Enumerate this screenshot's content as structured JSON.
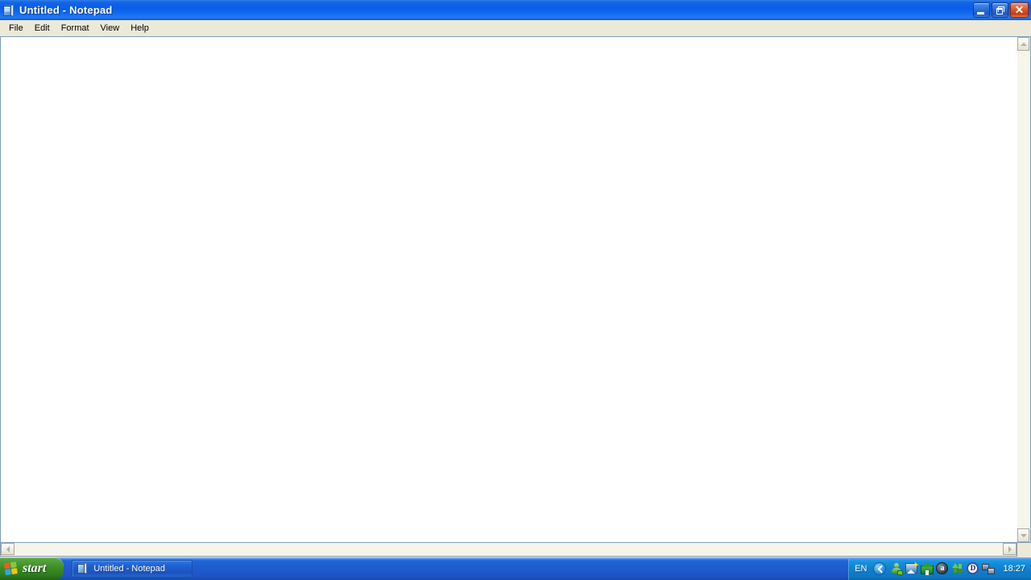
{
  "window": {
    "title": "Untitled - Notepad",
    "icon": "notepad-document-icon",
    "buttons": {
      "minimize": "_",
      "restore": "restore",
      "close": "✕"
    }
  },
  "menu": {
    "items": [
      {
        "label": "File"
      },
      {
        "label": "Edit"
      },
      {
        "label": "Format"
      },
      {
        "label": "View"
      },
      {
        "label": "Help"
      }
    ]
  },
  "editor": {
    "content": "",
    "scrollbars": {
      "vertical": {
        "up": "scroll-up",
        "down": "scroll-down"
      },
      "horizontal": {
        "left": "scroll-left",
        "right": "scroll-right"
      }
    }
  },
  "taskbar": {
    "start": {
      "label": "start",
      "icon": "windows-flag-icon"
    },
    "task_buttons": [
      {
        "label": "Untitled - Notepad",
        "icon": "notepad-document-icon",
        "active": true
      }
    ],
    "tray": {
      "language": "EN",
      "show_hidden": "chevron-left-icon",
      "icons": [
        {
          "name": "contacts-icon"
        },
        {
          "name": "picture-new-icon"
        },
        {
          "name": "home-icon"
        },
        {
          "name": "acrobat-icon",
          "letter": "a"
        },
        {
          "name": "updown-arrows-icon"
        },
        {
          "name": "daemon-tools-icon",
          "letter": "D"
        },
        {
          "name": "network-connection-icon"
        }
      ],
      "clock": "18:27"
    }
  },
  "colors": {
    "title_bar_blue": "#0A5EE6",
    "window_face": "#ECE9D8",
    "taskbar_blue": "#2059CE",
    "start_green": "#3C8F28",
    "tray_blue": "#0F7FCE",
    "close_red": "#C33C12",
    "editor_border": "#7F9DB9"
  }
}
